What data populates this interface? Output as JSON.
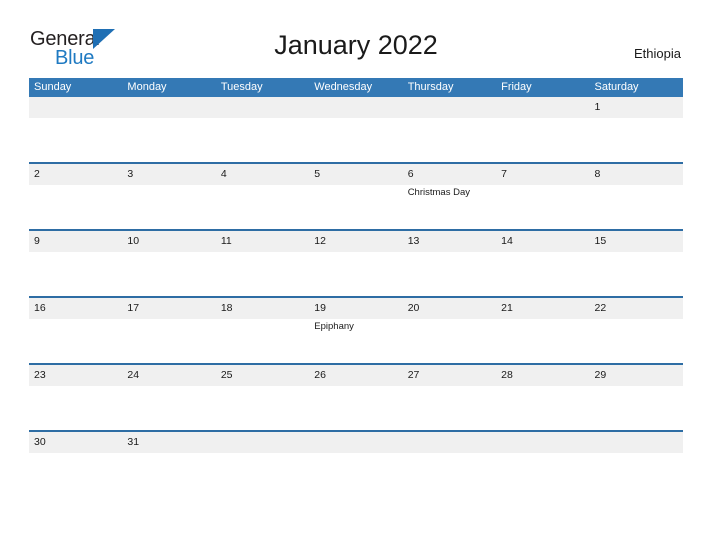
{
  "logo": {
    "word_one": "General",
    "word_two": "Blue",
    "triangle_icon": "triangle-right-icon",
    "accent_color": "#1f7ac2"
  },
  "header": {
    "title": "January 2022",
    "country": "Ethiopia"
  },
  "colors": {
    "weekday_header_bg": "#3479b5",
    "week_separator": "#2e6da4",
    "day_band_bg": "#f0f0f0",
    "text": "#1a1a1a"
  },
  "calendar": {
    "weekdays": [
      "Sunday",
      "Monday",
      "Tuesday",
      "Wednesday",
      "Thursday",
      "Friday",
      "Saturday"
    ],
    "weeks": [
      {
        "days": [
          {
            "num": "",
            "event": ""
          },
          {
            "num": "",
            "event": ""
          },
          {
            "num": "",
            "event": ""
          },
          {
            "num": "",
            "event": ""
          },
          {
            "num": "",
            "event": ""
          },
          {
            "num": "",
            "event": ""
          },
          {
            "num": "1",
            "event": ""
          }
        ]
      },
      {
        "days": [
          {
            "num": "2",
            "event": ""
          },
          {
            "num": "3",
            "event": ""
          },
          {
            "num": "4",
            "event": ""
          },
          {
            "num": "5",
            "event": ""
          },
          {
            "num": "6",
            "event": "Christmas Day"
          },
          {
            "num": "7",
            "event": ""
          },
          {
            "num": "8",
            "event": ""
          }
        ]
      },
      {
        "days": [
          {
            "num": "9",
            "event": ""
          },
          {
            "num": "10",
            "event": ""
          },
          {
            "num": "11",
            "event": ""
          },
          {
            "num": "12",
            "event": ""
          },
          {
            "num": "13",
            "event": ""
          },
          {
            "num": "14",
            "event": ""
          },
          {
            "num": "15",
            "event": ""
          }
        ]
      },
      {
        "days": [
          {
            "num": "16",
            "event": ""
          },
          {
            "num": "17",
            "event": ""
          },
          {
            "num": "18",
            "event": ""
          },
          {
            "num": "19",
            "event": "Epiphany"
          },
          {
            "num": "20",
            "event": ""
          },
          {
            "num": "21",
            "event": ""
          },
          {
            "num": "22",
            "event": ""
          }
        ]
      },
      {
        "days": [
          {
            "num": "23",
            "event": ""
          },
          {
            "num": "24",
            "event": ""
          },
          {
            "num": "25",
            "event": ""
          },
          {
            "num": "26",
            "event": ""
          },
          {
            "num": "27",
            "event": ""
          },
          {
            "num": "28",
            "event": ""
          },
          {
            "num": "29",
            "event": ""
          }
        ]
      },
      {
        "days": [
          {
            "num": "30",
            "event": ""
          },
          {
            "num": "31",
            "event": ""
          },
          {
            "num": "",
            "event": ""
          },
          {
            "num": "",
            "event": ""
          },
          {
            "num": "",
            "event": ""
          },
          {
            "num": "",
            "event": ""
          },
          {
            "num": "",
            "event": ""
          }
        ]
      }
    ]
  }
}
